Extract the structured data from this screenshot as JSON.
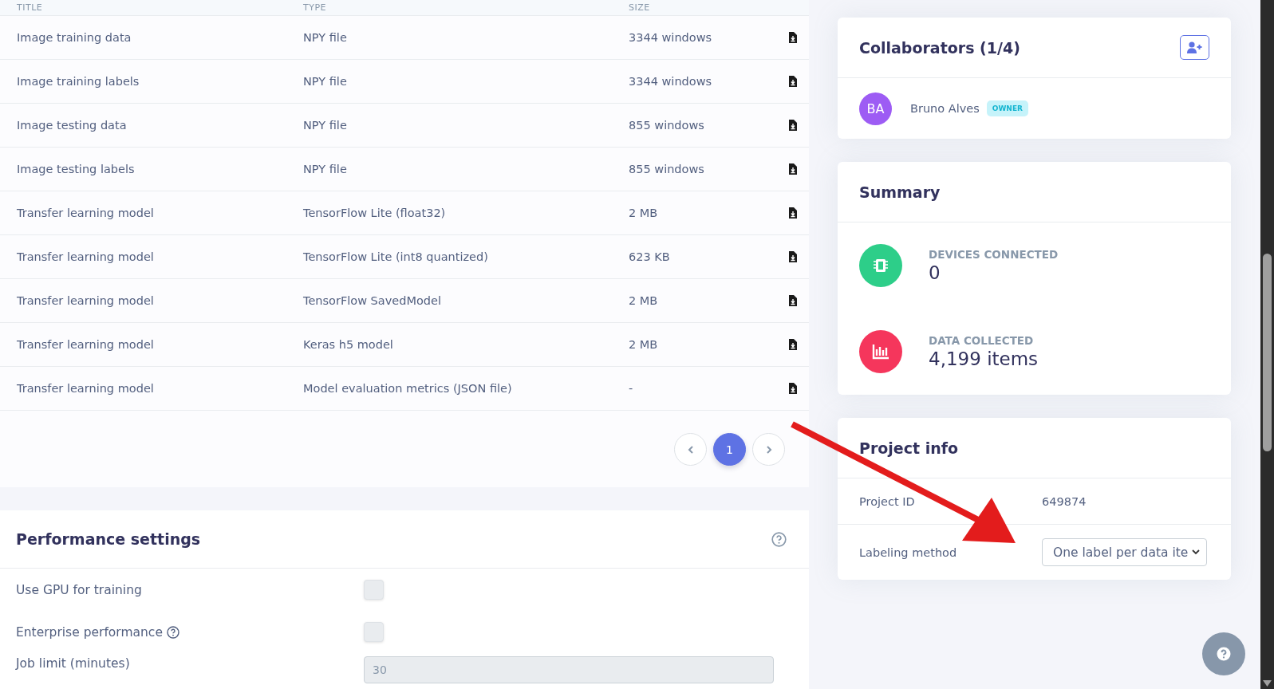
{
  "files": {
    "columns": [
      "TITLE",
      "TYPE",
      "SIZE"
    ],
    "rows": [
      {
        "title": "Image training data",
        "type": "NPY file",
        "size": "3344 windows"
      },
      {
        "title": "Image training labels",
        "type": "NPY file",
        "size": "3344 windows"
      },
      {
        "title": "Image testing data",
        "type": "NPY file",
        "size": "855 windows"
      },
      {
        "title": "Image testing labels",
        "type": "NPY file",
        "size": "855 windows"
      },
      {
        "title": "Transfer learning model",
        "type": "TensorFlow Lite (float32)",
        "size": "2 MB"
      },
      {
        "title": "Transfer learning model",
        "type": "TensorFlow Lite (int8 quantized)",
        "size": "623 KB"
      },
      {
        "title": "Transfer learning model",
        "type": "TensorFlow SavedModel",
        "size": "2 MB"
      },
      {
        "title": "Transfer learning model",
        "type": "Keras h5 model",
        "size": "2 MB"
      },
      {
        "title": "Transfer learning model",
        "type": "Model evaluation metrics (JSON file)",
        "size": "-"
      }
    ],
    "pages": [
      {
        "label": "1",
        "selected": true
      }
    ]
  },
  "performance": {
    "title": "Performance settings",
    "settings": [
      {
        "kind": "checkbox",
        "label": "Use GPU for training",
        "help": false,
        "checked": false
      },
      {
        "kind": "checkbox",
        "label": "Enterprise performance",
        "help": true,
        "checked": false
      },
      {
        "kind": "number",
        "label": "Job limit (minutes)",
        "value": "30"
      }
    ]
  },
  "collaborators": {
    "title": "Collaborators (1/4)",
    "members": [
      {
        "initials": "BA",
        "name": "Bruno Alves",
        "role": "OWNER"
      }
    ]
  },
  "summary": {
    "title": "Summary",
    "stats": [
      {
        "kind": "devices",
        "label": "DEVICES CONNECTED",
        "value": "0"
      },
      {
        "kind": "data",
        "label": "DATA COLLECTED",
        "value": "4,199 items"
      }
    ]
  },
  "project_info": {
    "title": "Project info",
    "fields": [
      {
        "kind": "text",
        "label": "Project ID",
        "value": "649874"
      },
      {
        "kind": "select",
        "label": "Labeling method",
        "value": "One label per data ite"
      }
    ]
  }
}
